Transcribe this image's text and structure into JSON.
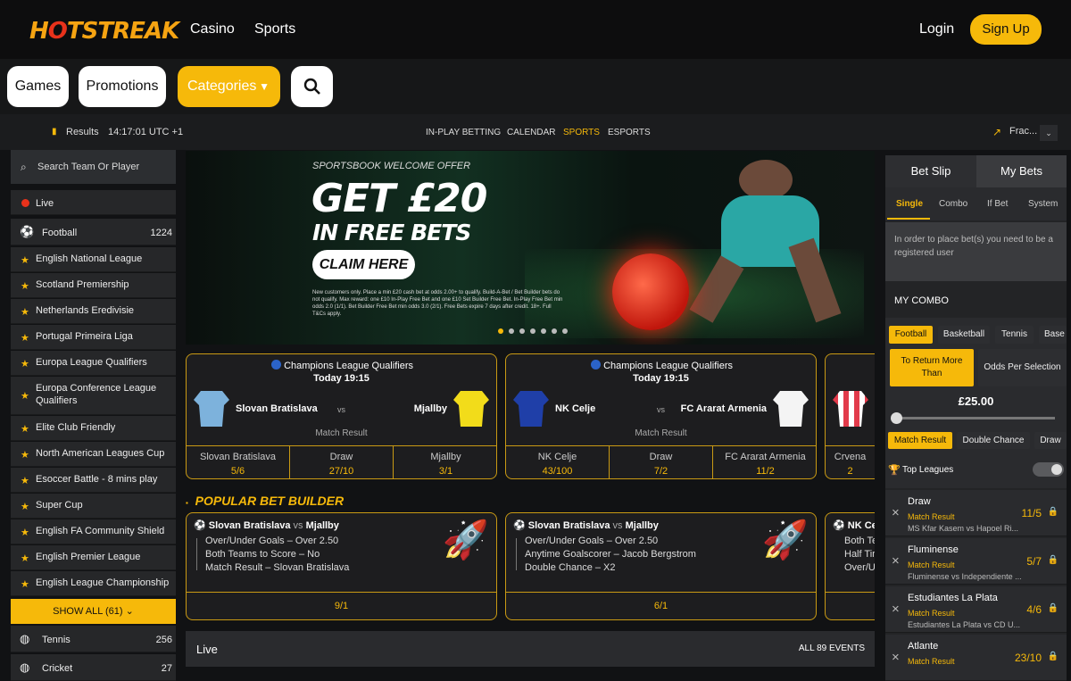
{
  "header": {
    "logo": "HOTSTREAK",
    "nav": [
      "Casino",
      "Sports"
    ],
    "login": "Login",
    "signup": "Sign Up"
  },
  "pills": {
    "games": "Games",
    "promotions": "Promotions",
    "categories": "Categories"
  },
  "subbar": {
    "results": "Results",
    "time": "14:17:01 UTC +1",
    "links": [
      "IN-PLAY BETTING",
      "CALENDAR",
      "SPORTS",
      "ESPORTS"
    ],
    "odds_format": "Frac..."
  },
  "sidebar": {
    "search_placeholder": "Search Team Or Player",
    "live": "Live",
    "football": "Football",
    "football_count": "1224",
    "leagues": [
      "English National League",
      "Scotland Premiership",
      "Netherlands Eredivisie",
      "Portugal Primeira Liga",
      "Europa League Qualifiers",
      "Europa Conference League Qualifiers",
      "Elite Club Friendly",
      "North American Leagues Cup",
      "Esoccer Battle - 8 mins play",
      "Super Cup",
      "English FA Community Shield",
      "English Premier League",
      "English League Championship"
    ],
    "show_all": "SHOW ALL (61)",
    "tennis": "Tennis",
    "tennis_count": "256",
    "cricket": "Cricket",
    "cricket_count": "27"
  },
  "banner": {
    "kicker": "SPORTSBOOK WELCOME OFFER",
    "headline1": "GET £20",
    "headline2": "IN FREE BETS",
    "cta": "CLAIM HERE",
    "terms": "New customers only. Place a min £20 cash bet at odds 2.00+ to qualify. Build-A-Bet / Bet Builder bets do not qualify. Max reward: one £10 In-Play Free Bet and one £10 Set Builder Free Bet. In-Play Free Bet min odds 2.0 (1/1). Bet Builder Free Bet min odds 3.0 (2/1). Free Bets expire 7 days after credit. 18+. Full T&Cs apply."
  },
  "matches": [
    {
      "comp": "Champions League Qualifiers",
      "time": "Today 19:15",
      "home": "Slovan Bratislava",
      "away": "Mjallby",
      "vs": "vs",
      "market": "Match Result",
      "odds": [
        {
          "label": "Slovan Bratislava",
          "price": "5/6"
        },
        {
          "label": "Draw",
          "price": "27/10"
        },
        {
          "label": "Mjallby",
          "price": "3/1"
        }
      ]
    },
    {
      "comp": "Champions League Qualifiers",
      "time": "Today 19:15",
      "home": "NK Celje",
      "away": "FC Ararat Armenia",
      "vs": "vs",
      "market": "Match Result",
      "odds": [
        {
          "label": "NK Celje",
          "price": "43/100"
        },
        {
          "label": "Draw",
          "price": "7/2"
        },
        {
          "label": "FC Ararat Armenia",
          "price": "11/2"
        }
      ]
    },
    {
      "partial_label": "Crvena",
      "partial_price": "2"
    }
  ],
  "bet_builder": {
    "heading": "POPULAR BET BUILDER",
    "cards": [
      {
        "home": "Slovan Bratislava",
        "vs": "vs",
        "away": "Mjallby",
        "legs": [
          "Over/Under Goals – Over 2.50",
          "Both Teams to Score – No",
          "Match Result – Slovan Bratislava"
        ],
        "price": "9/1"
      },
      {
        "home": "Slovan Bratislava",
        "vs": "vs",
        "away": "Mjallby",
        "legs": [
          "Over/Under Goals – Over 2.50",
          "Anytime Goalscorer – Jacob Bergstrom",
          "Double Chance – X2"
        ],
        "price": "6/1"
      },
      {
        "home": "NK Ce",
        "legs": [
          "Both Te",
          "Half Tir",
          "Over/U"
        ]
      }
    ]
  },
  "live_bar": {
    "label": "Live",
    "all_events": "ALL 89 EVENTS"
  },
  "betslip": {
    "tabs": [
      "Bet Slip",
      "My Bets"
    ],
    "types": [
      "Single",
      "Combo",
      "If Bet",
      "System"
    ],
    "notice": "In order to place bet(s) you need to be a registered user",
    "my_combo": "MY COMBO",
    "sports": [
      "Football",
      "Basketball",
      "Tennis",
      "Base"
    ],
    "return_btn": "To Return More Than",
    "odds_btn": "Odds Per Selection",
    "amount": "£25.00",
    "markets": [
      "Match Result",
      "Double Chance",
      "Draw"
    ],
    "top_leagues": "Top Leagues",
    "selections": [
      {
        "name": "Draw",
        "market": "Match Result",
        "event": "MS Kfar Kasem vs Hapoel Ri...",
        "price": "11/5"
      },
      {
        "name": "Fluminense",
        "market": "Match Result",
        "event": "Fluminense vs Independiente ...",
        "price": "5/7"
      },
      {
        "name": "Estudiantes La Plata",
        "market": "Match Result",
        "event": "Estudiantes La Plata vs CD U...",
        "price": "4/6"
      },
      {
        "name": "Atlante",
        "market": "Match Result",
        "event": "",
        "price": "23/10"
      }
    ]
  },
  "colors": {
    "accent": "#f6b90a",
    "background": "#111214",
    "panel": "#232426"
  }
}
